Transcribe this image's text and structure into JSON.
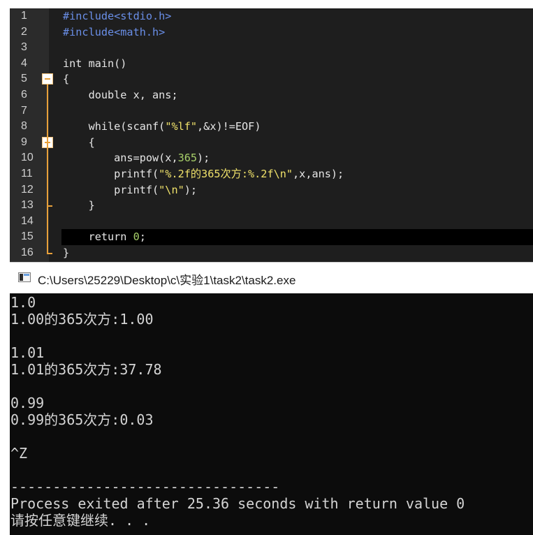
{
  "editor": {
    "lines": [
      {
        "n": "1",
        "segments": [
          {
            "c": "pp",
            "t": "#include<stdio.h>"
          }
        ]
      },
      {
        "n": "2",
        "segments": [
          {
            "c": "pp",
            "t": "#include<math.h>"
          }
        ]
      },
      {
        "n": "3",
        "segments": []
      },
      {
        "n": "4",
        "segments": [
          {
            "c": "kw",
            "t": "int main()"
          }
        ]
      },
      {
        "n": "5",
        "segments": [
          {
            "c": "kw",
            "t": "{"
          }
        ]
      },
      {
        "n": "6",
        "segments": [
          {
            "c": "kw",
            "t": "    double x, ans;"
          }
        ]
      },
      {
        "n": "7",
        "segments": []
      },
      {
        "n": "8",
        "segments": [
          {
            "c": "kw",
            "t": "    while(scanf("
          },
          {
            "c": "str",
            "t": "\"%lf\""
          },
          {
            "c": "kw",
            "t": ",&x)!=EOF)"
          }
        ]
      },
      {
        "n": "9",
        "segments": [
          {
            "c": "kw",
            "t": "    {"
          }
        ]
      },
      {
        "n": "10",
        "segments": [
          {
            "c": "kw",
            "t": "        ans=pow(x,"
          },
          {
            "c": "num",
            "t": "365"
          },
          {
            "c": "kw",
            "t": ");"
          }
        ]
      },
      {
        "n": "11",
        "segments": [
          {
            "c": "kw",
            "t": "        printf("
          },
          {
            "c": "str",
            "t": "\"%.2f的365次方:%.2f\\n\""
          },
          {
            "c": "kw",
            "t": ",x,ans);"
          }
        ]
      },
      {
        "n": "12",
        "segments": [
          {
            "c": "kw",
            "t": "        printf("
          },
          {
            "c": "str",
            "t": "\"\\n\""
          },
          {
            "c": "kw",
            "t": ");"
          }
        ]
      },
      {
        "n": "13",
        "segments": [
          {
            "c": "kw",
            "t": "    }"
          }
        ]
      },
      {
        "n": "14",
        "segments": []
      },
      {
        "n": "15",
        "segments": [
          {
            "c": "kw",
            "t": "    return "
          },
          {
            "c": "num",
            "t": "0"
          },
          {
            "c": "kw",
            "t": ";"
          }
        ]
      },
      {
        "n": "16",
        "segments": [
          {
            "c": "kw",
            "t": "}"
          }
        ]
      }
    ],
    "current_line": "15"
  },
  "console": {
    "title": "C:\\Users\\25229\\Desktop\\c\\实验1\\task2\\task2.exe",
    "output": [
      "1.0",
      "1.00的365次方:1.00",
      "",
      "1.01",
      "1.01的365次方:37.78",
      "",
      "0.99",
      "0.99的365次方:0.03",
      "",
      "^Z",
      "",
      "--------------------------------",
      "Process exited after 25.36 seconds with return value 0",
      "请按任意键继续. . ."
    ]
  },
  "colors": {
    "editor_bg": "#1e1e1e",
    "preprocessor": "#6a8fe8",
    "string": "#f0e26a",
    "number": "#a8d06a",
    "fold_marker": "#e8a03a",
    "console_bg": "#0c0c0c"
  }
}
